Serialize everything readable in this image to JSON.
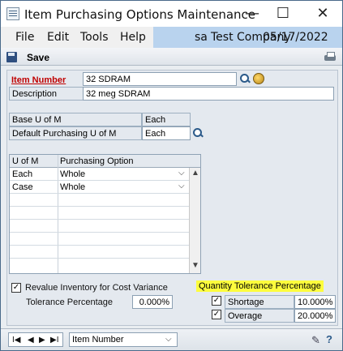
{
  "window": {
    "title": "Item Purchasing Options Maintenance",
    "controls": {
      "minimize": "—",
      "maximize": "☐",
      "close": "✕"
    }
  },
  "menu": {
    "items": [
      "File",
      "Edit",
      "Tools",
      "Help"
    ]
  },
  "company_bar": {
    "user": "sa",
    "company": "Test Company",
    "date": "05/17/2022"
  },
  "toolbar": {
    "save_label": "Save"
  },
  "form": {
    "item_number_label": "Item Number",
    "item_number_value": "32 SDRAM",
    "description_label": "Description",
    "description_value": "32 meg SDRAM",
    "base_uom_label": "Base U of M",
    "base_uom_value": "Each",
    "default_purchasing_uom_label": "Default Purchasing U of M",
    "default_purchasing_uom_value": "Each"
  },
  "grid": {
    "columns": [
      "U of M",
      "Purchasing Option"
    ],
    "rows": [
      {
        "uom": "Each",
        "option": "Whole"
      },
      {
        "uom": "Case",
        "option": "Whole"
      }
    ]
  },
  "revalue": {
    "label": "Revalue Inventory for Cost Variance",
    "checked": true,
    "tolerance_label": "Tolerance Percentage",
    "tolerance_value": "0.000%"
  },
  "quantity_tolerance": {
    "heading": "Quantity Tolerance Percentage",
    "shortage_label": "Shortage",
    "shortage_checked": true,
    "shortage_value": "10.000%",
    "overage_label": "Overage",
    "overage_checked": true,
    "overage_value": "20.000%"
  },
  "navigation": {
    "sort_value": "Item Number"
  },
  "colors": {
    "accent": "#b9d3ee",
    "highlight": "#fdfd3d",
    "required_label": "#c00000"
  }
}
